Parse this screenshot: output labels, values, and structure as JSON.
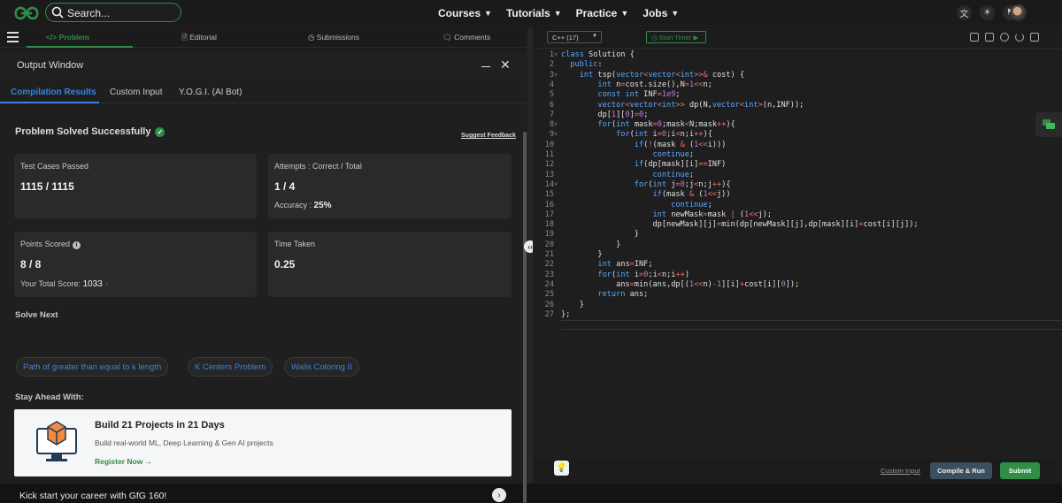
{
  "topbar": {
    "search_placeholder": "Search...",
    "nav": [
      {
        "label": "Courses",
        "icon": "chevron-down-icon"
      },
      {
        "label": "Tutorials",
        "icon": "chevron-down-icon"
      },
      {
        "label": "Practice",
        "icon": "chevron-down-icon"
      },
      {
        "label": "Jobs",
        "icon": "chevron-down-icon"
      }
    ],
    "icons": [
      "translate-icon",
      "theme-icon",
      "bell-icon",
      "avatar"
    ]
  },
  "problem_tabs": {
    "problem": "</> Problem",
    "editorial": "Editorial",
    "submissions": "Submissions",
    "comments": "Comments"
  },
  "output": {
    "title": "Output Window",
    "tabs": [
      "Compilation Results",
      "Custom Input",
      "Y.O.G.I. (AI Bot)"
    ],
    "status": "Problem Solved Successfully",
    "suggest": "Suggest Feedback",
    "cards": {
      "tests_label": "Test Cases Passed",
      "tests_value": "1115 / 1115",
      "attempts_label": "Attempts : Correct / Total",
      "attempts_value": "1 / 4",
      "accuracy_label": "Accuracy :",
      "accuracy_value": "25%",
      "points_label": "Points Scored",
      "points_value": "8 / 8",
      "total_label": "Your Total Score:",
      "total_value": "1033",
      "time_label": "Time Taken",
      "time_value": "0.25"
    },
    "solve_next_heading": "Solve Next",
    "solve_next": [
      "Path of greater than equal to k length",
      "K Centers Problem",
      "Walls Coloring II"
    ],
    "stay_ahead_heading": "Stay Ahead With:",
    "promo": {
      "title": "Build 21 Projects in 21 Days",
      "subtitle": "Build real-world ML, Deep Learning & Gen AI projects",
      "link": "Register Now →"
    },
    "kickstart": "Kick start your career with GfG 160!"
  },
  "editor": {
    "language": "C++ (17)",
    "timer": "Start Timer",
    "line_numbers": [
      "1",
      "2",
      "3",
      "4",
      "5",
      "6",
      "7",
      "8",
      "9",
      "10",
      "11",
      "12",
      "13",
      "14",
      "15",
      "16",
      "17",
      "18",
      "19",
      "20",
      "21",
      "22",
      "23",
      "24",
      "25",
      "26",
      "27"
    ],
    "code": [
      "class Solution {",
      "  public:",
      "    int tsp(vector<vector<int>>& cost) {",
      "        int n=cost.size(),N=1<<n;",
      "        const int INF=1e9;",
      "        vector<vector<int>> dp(N,vector<int>(n,INF));",
      "        dp[1][0]=0;",
      "        for(int mask=0;mask<N;mask++){",
      "            for(int i=0;i<n;i++){",
      "                if(!(mask & (1<<i)))",
      "                    continue;",
      "                if(dp[mask][i]==INF)",
      "                    continue;",
      "                for(int j=0;j<n;j++){",
      "                    if(mask & (1<<j))",
      "                        continue;",
      "                    int newMask=mask | (1<<j);",
      "                    dp[newMask][j]=min(dp[newMask][j],dp[mask][i]+cost[i][j]);",
      "                }",
      "            }",
      "        }",
      "        int ans=INF;",
      "        for(int i=0;i<n;i++)",
      "            ans=min(ans,dp[(1<<n)-1][i]+cost[i][0]);",
      "        return ans;",
      "    }",
      "};"
    ],
    "custom_input": "Custom Input",
    "compile": "Compile & Run",
    "submit": "Submit"
  },
  "colors": {
    "accent": "#2f8d46",
    "link": "#3b82d9"
  }
}
